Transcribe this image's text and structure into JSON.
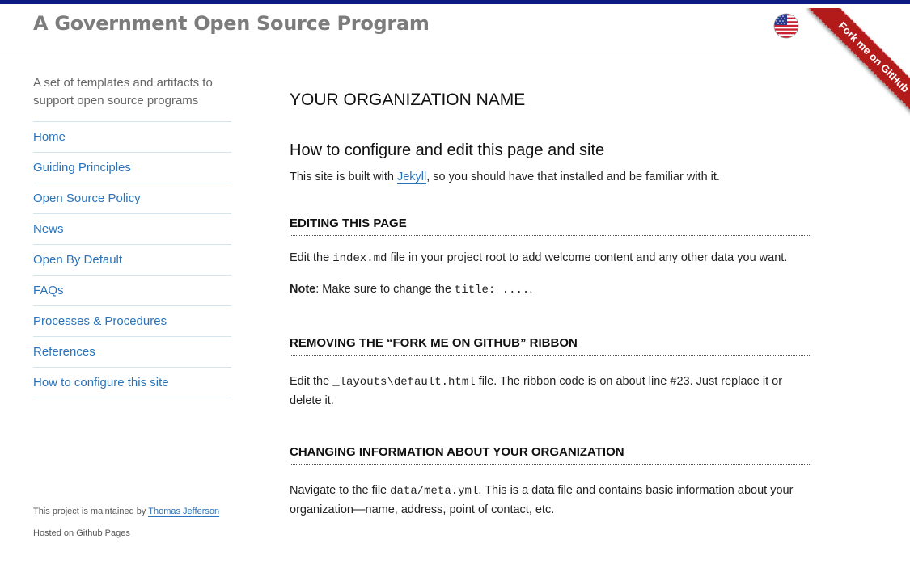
{
  "header": {
    "site_title": "A Government Open Source Program",
    "flag_icon": "us-flag-icon",
    "ribbon_text": "Fork me on GitHub"
  },
  "sidebar": {
    "tagline": "A set of templates and artifacts to support open source programs",
    "items": [
      {
        "label": "Home"
      },
      {
        "label": "Guiding Principles"
      },
      {
        "label": "Open Source Policy"
      },
      {
        "label": "News"
      },
      {
        "label": "Open By Default"
      },
      {
        "label": "FAQs"
      },
      {
        "label": "Processes & Procedures"
      },
      {
        "label": "References"
      },
      {
        "label": "How to configure this site"
      }
    ],
    "footer": {
      "maintained_prefix": "This project is maintained by ",
      "maintainer": "Thomas Jefferson",
      "hosted": "Hosted on Github Pages"
    }
  },
  "main": {
    "org_name": "YOUR ORGANIZATION NAME",
    "section_title": "How to configure and edit this page and site",
    "intro": {
      "before": "This site is built with ",
      "link": "Jekyll",
      "after": ", so you should have that installed and be familiar with it."
    },
    "editing": {
      "heading": "EDITING THIS PAGE",
      "text_before": "Edit the ",
      "code": "index.md",
      "text_after": " file in your project root to add welcome content and any other data you want.",
      "note_label": "Note",
      "note_before": ": Make sure to change the ",
      "note_code": "title: ....",
      "note_after": "."
    },
    "ribbon_section": {
      "heading": "REMOVING THE “FORK ME ON GITHUB” RIBBON",
      "text_before": "Edit the ",
      "code": "_layouts\\default.html",
      "text_after": " file. The ribbon code is on about line #23. Just replace it or delete it."
    },
    "org_section": {
      "heading": "CHANGING INFORMATION ABOUT YOUR ORGANIZATION",
      "text_before": "Navigate to the file ",
      "code": "data/meta.yml",
      "text_after": ". This is a data file and contains basic information about your organization—name, address, point of contact, etc."
    }
  }
}
